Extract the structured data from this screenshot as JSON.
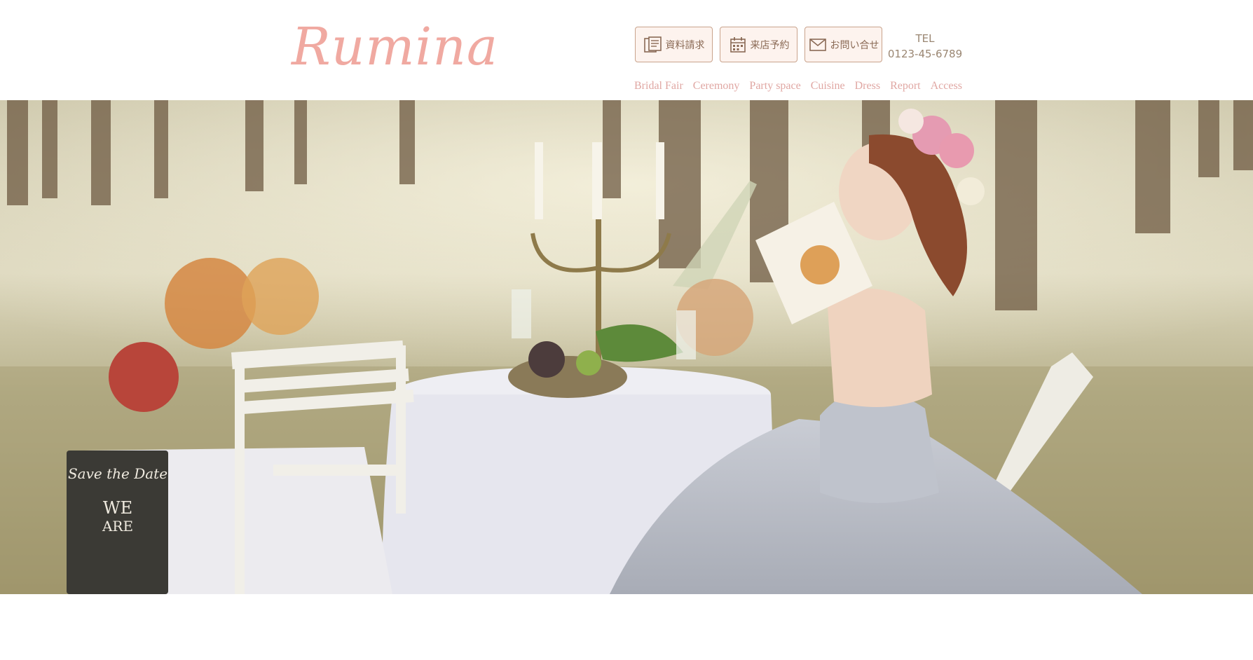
{
  "brand": {
    "logo_text": "Rumina",
    "color": "#f0a9a1"
  },
  "header": {
    "actions": [
      {
        "label": "資料請求",
        "icon": "document-icon"
      },
      {
        "label": "来店予約",
        "icon": "calendar-icon"
      },
      {
        "label": "お問い合せ",
        "icon": "mail-icon"
      }
    ],
    "tel": {
      "label": "TEL",
      "number": "0123-45-6789"
    }
  },
  "nav": {
    "items": [
      {
        "label": "Bridal Fair"
      },
      {
        "label": "Ceremony"
      },
      {
        "label": "Party space"
      },
      {
        "label": "Cuisine"
      },
      {
        "label": "Dress"
      },
      {
        "label": "Report"
      },
      {
        "label": "Access"
      }
    ]
  },
  "hero": {
    "image": "wedding-photo",
    "chalkboard_text": [
      "Save the Date",
      "WE",
      "ARE"
    ]
  },
  "colors": {
    "accent": "#e0a7a3",
    "button_border": "#c9a38c",
    "button_bg": "#fdf3ee",
    "text_muted": "#9a8672"
  }
}
